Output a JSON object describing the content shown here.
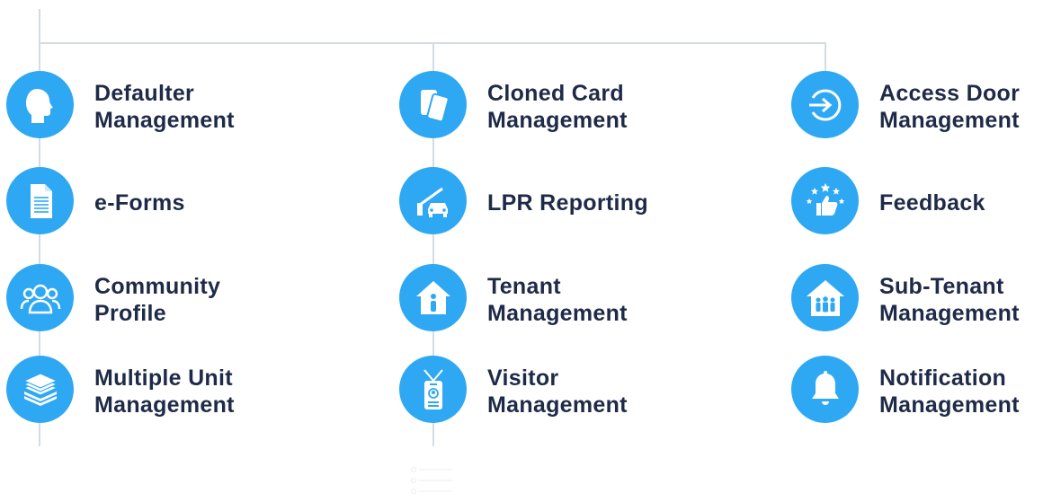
{
  "columns": [
    {
      "items": [
        {
          "icon": "head-profile-icon",
          "lines": [
            "Defaulter",
            "Management"
          ]
        },
        {
          "icon": "document-icon",
          "lines": [
            "e-Forms"
          ]
        },
        {
          "icon": "people-group-icon",
          "lines": [
            "Community",
            "Profile"
          ]
        },
        {
          "icon": "layers-icon",
          "lines": [
            "Multiple Unit",
            "Management"
          ]
        }
      ]
    },
    {
      "items": [
        {
          "icon": "cards-icon",
          "lines": [
            "Cloned Card",
            "Management"
          ]
        },
        {
          "icon": "barrier-car-icon",
          "lines": [
            "LPR Reporting"
          ]
        },
        {
          "icon": "house-person-icon",
          "lines": [
            "Tenant",
            "Management"
          ]
        },
        {
          "icon": "visitor-badge-icon",
          "lines": [
            "Visitor",
            "Management"
          ]
        }
      ]
    },
    {
      "items": [
        {
          "icon": "enter-door-icon",
          "lines": [
            "Access Door",
            "Management"
          ]
        },
        {
          "icon": "thumbs-up-stars-icon",
          "lines": [
            "Feedback"
          ]
        },
        {
          "icon": "house-family-icon",
          "lines": [
            "Sub-Tenant",
            "Management"
          ]
        },
        {
          "icon": "bell-icon",
          "lines": [
            "Notification",
            "Management"
          ]
        }
      ]
    }
  ],
  "colors": {
    "accent": "#2fa8f4",
    "text": "#1e2a47",
    "connector": "#d4dbe6"
  }
}
